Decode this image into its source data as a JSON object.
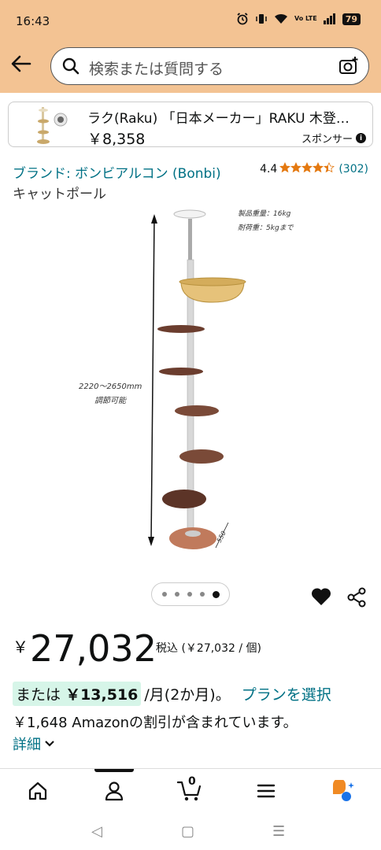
{
  "status": {
    "time": "16:43",
    "battery": "79",
    "volte": "Vo LTE"
  },
  "search": {
    "placeholder": "検索または質問する"
  },
  "sponsored": {
    "title": "ラク(Raku) 「日本メーカー」RAKU 木登…",
    "price": "￥8,358",
    "label": "スポンサー"
  },
  "product": {
    "brand": "ブランド: ボンビアルコン (Bonbi)",
    "rating_value": "4.4",
    "rating_stars": 4.4,
    "rating_count": "(302)",
    "category": "キャットポール",
    "image_text": {
      "weight": "製品重量：16kg",
      "load": "耐荷重：5kgまで",
      "height_range": "2220～2650mm",
      "adjustable": "調節可能",
      "base_size": "550"
    },
    "carousel": {
      "count": 5,
      "active": 5
    }
  },
  "pricing": {
    "yen": "￥",
    "price": "27,032",
    "tax_note": "税込 (￥27,032 / 個)",
    "installment_prefix": "または",
    "installment_amount": "￥13,516",
    "installment_period": "/月(2か月)。",
    "plan_link": "プランを選択",
    "discount": "￥1,648 Amazonの割引が含まれています。",
    "details": "詳細"
  },
  "bottom_nav": {
    "items": [
      "home-icon",
      "account-icon",
      "cart-icon",
      "menu-icon",
      "assistant-icon"
    ],
    "cart_count": "0"
  },
  "colors": {
    "header_bg": "#f3c393",
    "link": "#007185",
    "star": "#e47911",
    "installment_bg": "#d6f5e8"
  }
}
